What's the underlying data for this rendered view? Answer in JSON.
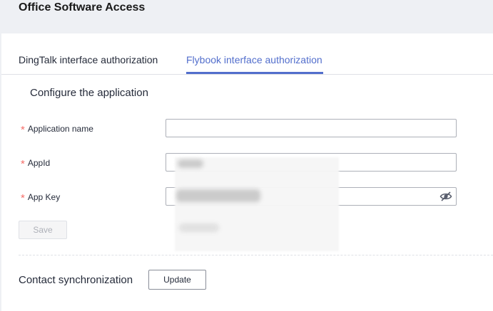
{
  "page": {
    "title": "Office Software Access"
  },
  "tabs": [
    {
      "label": "DingTalk interface authorization",
      "active": false
    },
    {
      "label": "Flybook interface authorization",
      "active": true
    }
  ],
  "section": {
    "title": "Configure the application"
  },
  "form": {
    "required_mark": "*",
    "fields": [
      {
        "label": "Application name",
        "value": ""
      },
      {
        "label": "AppId",
        "value": ""
      },
      {
        "label": "App Key",
        "value": ""
      }
    ],
    "save_label": "Save"
  },
  "contact_sync": {
    "label": "Contact synchronization",
    "update_label": "Update"
  },
  "colors": {
    "accent": "#526ecc",
    "required": "#f66f6a"
  },
  "icons": {
    "password_toggle": "eye-off-icon"
  }
}
